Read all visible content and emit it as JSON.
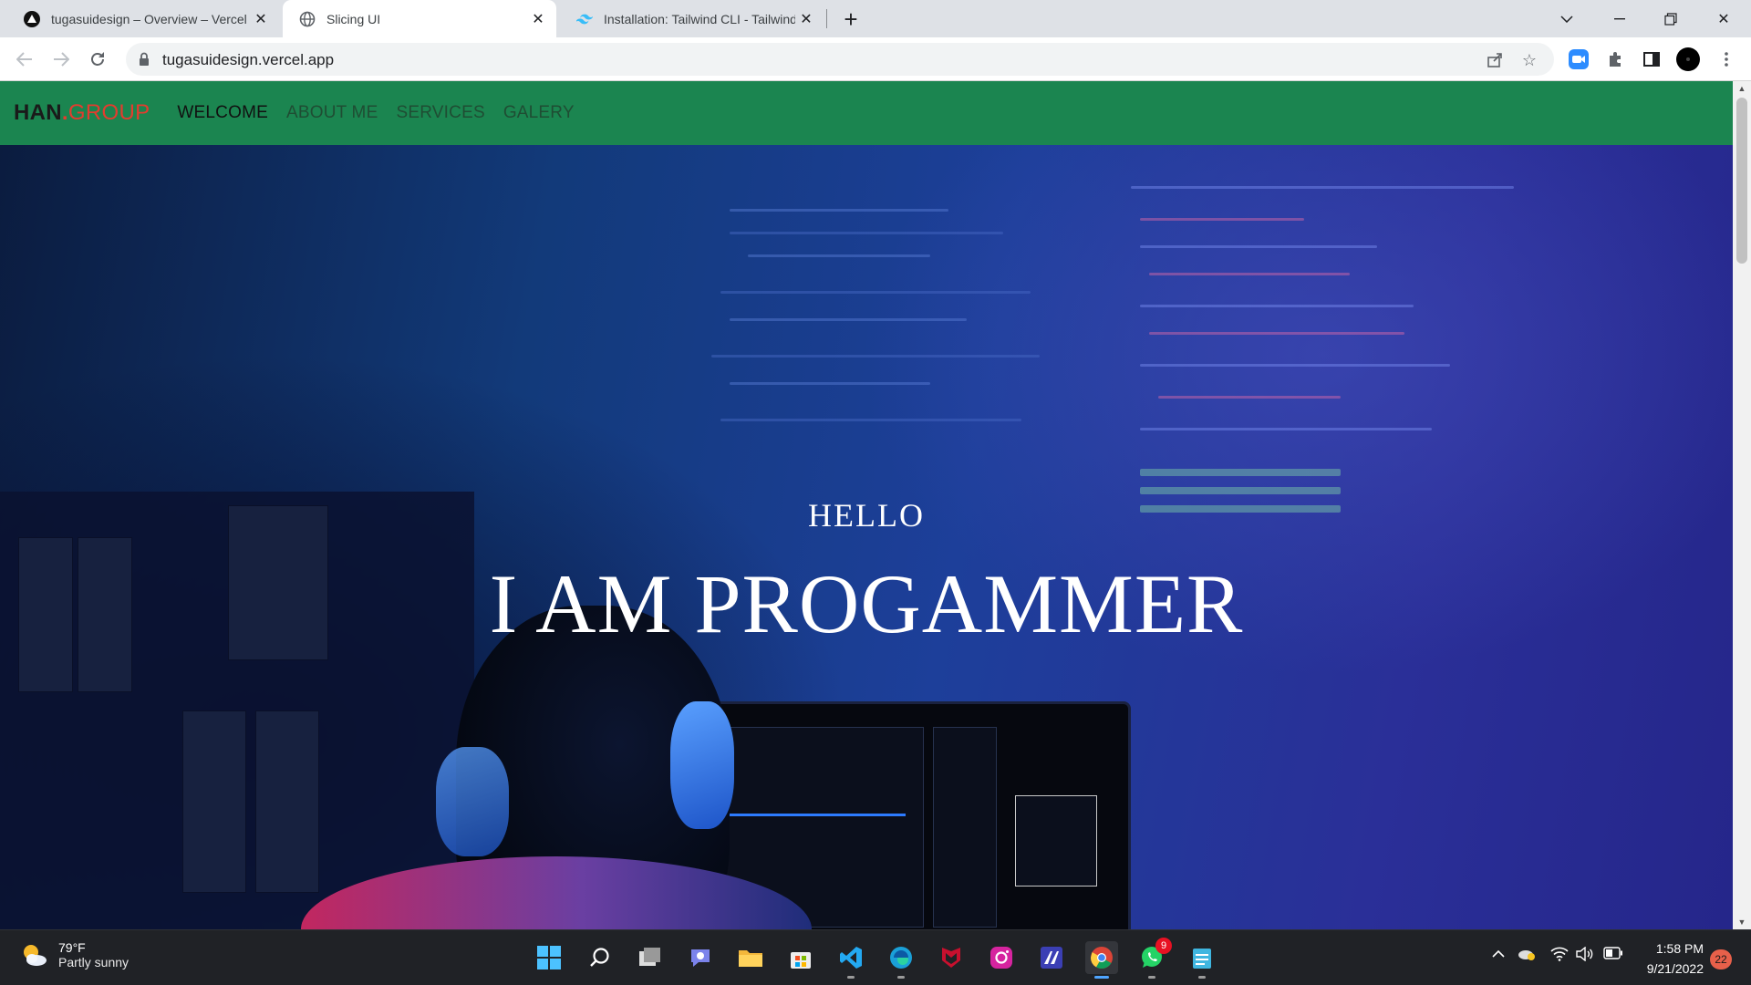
{
  "browser": {
    "tabs": [
      {
        "title": "tugasuidesign – Overview – Vercel",
        "icon": "vercel-icon"
      },
      {
        "title": "Slicing UI",
        "icon": "globe-icon",
        "active": true
      },
      {
        "title": "Installation: Tailwind CLI - Tailwind CSS",
        "icon": "tailwind-icon"
      }
    ],
    "url": "tugasuidesign.vercel.app"
  },
  "site": {
    "brand_main": "HAN",
    "brand_dot": ".",
    "brand_accent": "GROUP",
    "nav": [
      "WELCOME",
      "ABOUT ME",
      "SERVICES",
      "GALERY"
    ],
    "hero_small": "HELLO",
    "hero_big": "I AM PROGAMMER",
    "colors": {
      "nav_bg": "#1b8550",
      "brand_accent": "#e33c2e"
    }
  },
  "taskbar": {
    "weather_temp": "79°F",
    "weather_desc": "Partly sunny",
    "whatsapp_badge": "9",
    "time": "1:58 PM",
    "date": "9/21/2022",
    "notifications": "22"
  }
}
